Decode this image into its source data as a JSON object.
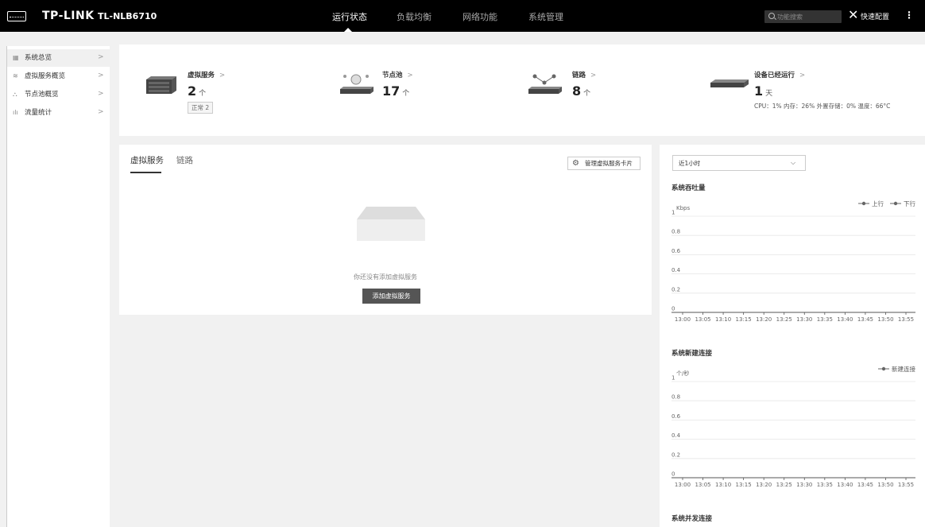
{
  "header": {
    "brand": "TP-LINK",
    "model": "TL-NLB6710",
    "nav": [
      {
        "label": "运行状态",
        "active": true
      },
      {
        "label": "负载均衡",
        "active": false
      },
      {
        "label": "网络功能",
        "active": false
      },
      {
        "label": "系统管理",
        "active": false
      }
    ],
    "search_placeholder": "功能搜索",
    "quick_config": "快速配置",
    "more": "⋮"
  },
  "sidebar": {
    "items": [
      {
        "label": "系统总览",
        "icon": "grid-icon",
        "active": true
      },
      {
        "label": "虚拟服务概览",
        "icon": "layers-icon",
        "active": false
      },
      {
        "label": "节点池概览",
        "icon": "nodes-icon",
        "active": false
      },
      {
        "label": "流量统计",
        "icon": "bar-chart-icon",
        "active": false
      }
    ]
  },
  "summary": {
    "virtual_service": {
      "title": "虚拟服务",
      "value": "2",
      "unit": "个",
      "badge": "正常 2"
    },
    "node_pool": {
      "title": "节点池",
      "value": "17",
      "unit": "个"
    },
    "links": {
      "title": "链路",
      "value": "8",
      "unit": "个"
    },
    "uptime": {
      "title": "设备已经运行",
      "value": "1",
      "unit": "天",
      "detail": "CPU：1%   内存：26%   外置存储：0%   温度：66°C"
    }
  },
  "vs_panel": {
    "tabs": [
      "虚拟服务",
      "链路"
    ],
    "manage_label": "管理虚拟服务卡片",
    "empty_text": "你还没有添加虚拟服务",
    "add_label": "添加虚拟服务"
  },
  "charts_panel": {
    "range": "近1小时"
  },
  "colors": {
    "topbar": "#000000",
    "accent": "#333333",
    "button_dark": "#555555"
  },
  "chart_data": [
    {
      "type": "line",
      "title": "系统吞吐量",
      "ylabel": "Kbps",
      "x": [
        "13:00",
        "13:05",
        "13:10",
        "13:15",
        "13:20",
        "13:25",
        "13:30",
        "13:35",
        "13:40",
        "13:45",
        "13:50",
        "13:55"
      ],
      "yticks": [
        "0",
        "0.2",
        "0.4",
        "0.6",
        "0.8",
        "1"
      ],
      "ylim": [
        0,
        1
      ],
      "series": [
        {
          "name": "上行",
          "values": []
        },
        {
          "name": "下行",
          "values": []
        }
      ],
      "legend": "top-right",
      "grid": true
    },
    {
      "type": "line",
      "title": "系统新建连接",
      "ylabel": "个/秒",
      "x": [
        "13:00",
        "13:05",
        "13:10",
        "13:15",
        "13:20",
        "13:25",
        "13:30",
        "13:35",
        "13:40",
        "13:45",
        "13:50",
        "13:55"
      ],
      "yticks": [
        "0",
        "0.2",
        "0.4",
        "0.6",
        "0.8",
        "1"
      ],
      "ylim": [
        0,
        1
      ],
      "series": [
        {
          "name": "新建连接",
          "values": []
        }
      ],
      "legend": "top-right",
      "grid": true
    },
    {
      "type": "line",
      "title": "系统并发连接"
    }
  ]
}
